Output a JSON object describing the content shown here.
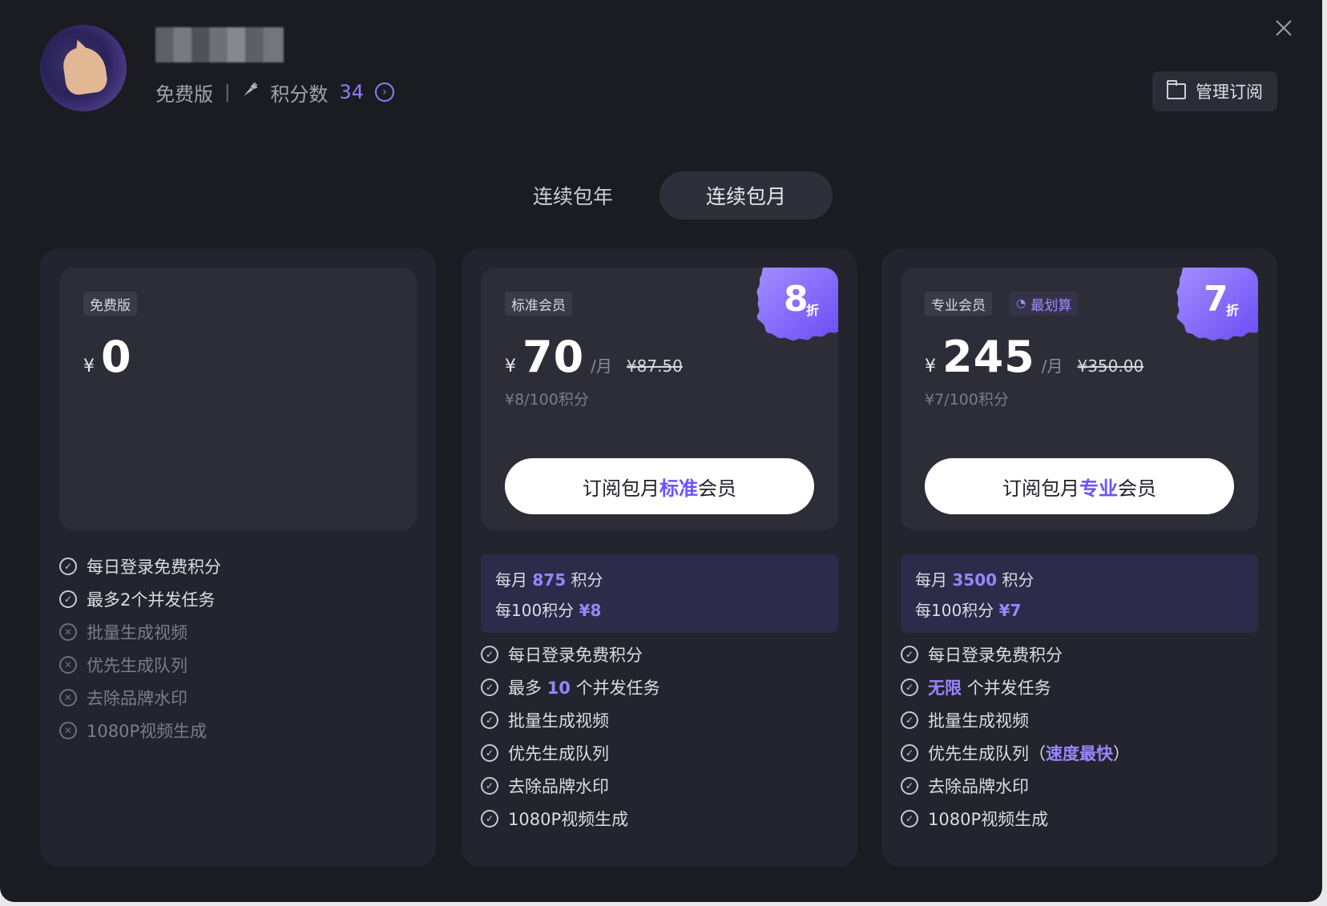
{
  "user": {
    "plan": "免费版",
    "points_label": "积分数",
    "points_value": "34",
    "separator": "|"
  },
  "header": {
    "manage_label": "管理订阅"
  },
  "tabs": [
    {
      "label": "连续包年",
      "selected": false
    },
    {
      "label": "连续包月",
      "selected": true
    }
  ],
  "plans": [
    {
      "tag": "免费版",
      "currency": "¥",
      "price": "0",
      "features": [
        {
          "text": "每日登录免费积分",
          "included": true
        },
        {
          "text": "最多2个并发任务",
          "included": true
        },
        {
          "text": "批量生成视频",
          "included": false
        },
        {
          "text": "优先生成队列",
          "included": false
        },
        {
          "text": "去除品牌水印",
          "included": false
        },
        {
          "text": "1080P视频生成",
          "included": false
        }
      ]
    },
    {
      "tag": "标准会员",
      "currency": "¥",
      "price": "70",
      "per": "/月",
      "original": "¥87.50",
      "unit_price": "¥8/100积分",
      "discount_num": "8",
      "discount_unit": "折",
      "button_prefix": "订阅包月",
      "button_highlight": "标准",
      "button_suffix": "会员",
      "summary_l1_pre": "每月",
      "summary_l1_val": "875",
      "summary_l1_post": "积分",
      "summary_l2_pre": "每100积分",
      "summary_l2_val": "¥8",
      "features": [
        {
          "text": "每日登录免费积分"
        },
        {
          "pre": "最多",
          "hl": "10",
          "post": "个并发任务"
        },
        {
          "text": "批量生成视频"
        },
        {
          "text": "优先生成队列"
        },
        {
          "text": "去除品牌水印"
        },
        {
          "text": "1080P视频生成"
        }
      ]
    },
    {
      "tag": "专业会员",
      "value_tag": "最划算",
      "currency": "¥",
      "price": "245",
      "per": "/月",
      "original": "¥350.00",
      "unit_price": "¥7/100积分",
      "discount_num": "7",
      "discount_unit": "折",
      "button_prefix": "订阅包月",
      "button_highlight": "专业",
      "button_suffix": "会员",
      "summary_l1_pre": "每月",
      "summary_l1_val": "3500",
      "summary_l1_post": "积分",
      "summary_l2_pre": "每100积分",
      "summary_l2_val": "¥7",
      "features": [
        {
          "text": "每日登录免费积分"
        },
        {
          "hl_first": "无限",
          "post": "个并发任务"
        },
        {
          "text": "批量生成视频"
        },
        {
          "pre": "优先生成队列（",
          "hl": "速度最快",
          "post": "）"
        },
        {
          "text": "去除品牌水印"
        },
        {
          "text": "1080P视频生成"
        }
      ]
    }
  ],
  "colors": {
    "accent": "#8f7dff",
    "background": "#1b1b22",
    "card": "#23242d",
    "discount_badge": "#7c62ff"
  },
  "icons": [
    "close-icon",
    "folder-icon",
    "carrot-icon",
    "chevron-right-icon",
    "check-circle-icon",
    "x-circle-icon",
    "fire-icon"
  ]
}
